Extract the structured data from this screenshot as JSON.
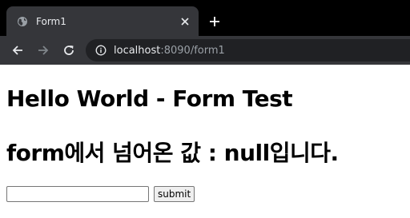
{
  "tab": {
    "title": "Form1",
    "globe_icon": "globe-icon",
    "close_icon": "close-icon"
  },
  "new_tab_icon": "plus-icon",
  "toolbar": {
    "back_icon": "back-arrow-icon",
    "forward_icon": "forward-arrow-icon",
    "reload_icon": "reload-icon",
    "info_icon": "info-icon",
    "url_host": "localhost",
    "url_rest": ":8090/form1"
  },
  "page": {
    "heading": "Hello World - Form Test",
    "result_text": "form에서 넘어온 값 : null입니다.",
    "input_value": "",
    "submit_label": "submit"
  },
  "colors": {
    "tabstrip_bg": "#000000",
    "tab_bg": "#35363a",
    "omnibox_bg": "#202124",
    "text_light": "#e8eaed",
    "text_dim": "#9aa0a6"
  }
}
